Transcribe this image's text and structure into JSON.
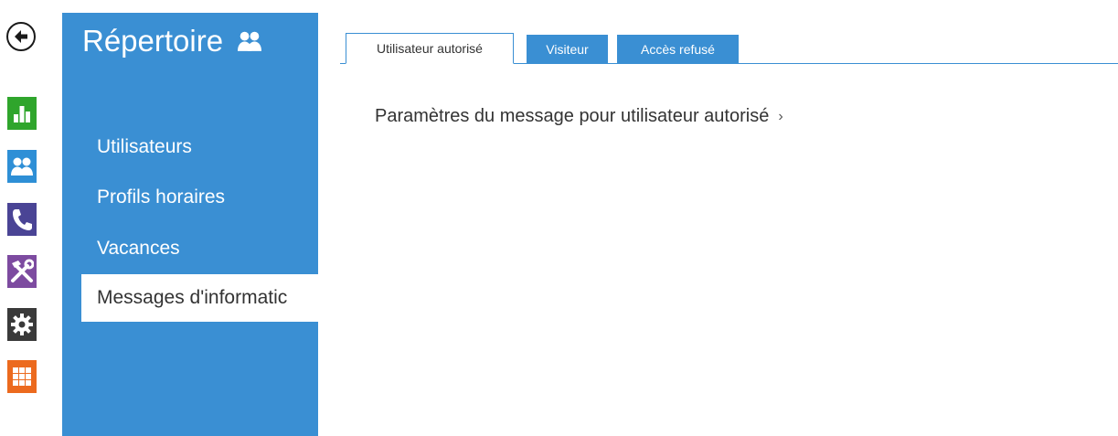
{
  "sidebar_rail": {
    "back_icon": "arrow-left-circle",
    "items": [
      {
        "name": "status",
        "icon": "bar-chart-icon",
        "color": "#2fa52c"
      },
      {
        "name": "directory",
        "icon": "users-icon",
        "color": "#2e8fd6"
      },
      {
        "name": "calls",
        "icon": "phone-icon",
        "color": "#4a4495"
      },
      {
        "name": "hardware",
        "icon": "tools-icon",
        "color": "#7d4ba0"
      },
      {
        "name": "services",
        "icon": "gear-icon",
        "color": "#3a3a3a"
      },
      {
        "name": "system",
        "icon": "grid-icon",
        "color": "#ec6a1e"
      }
    ]
  },
  "panel": {
    "title": "Répertoire",
    "title_icon": "users-icon",
    "color": "#3a8fd3",
    "menu": [
      {
        "label": "Utilisateurs"
      },
      {
        "label": "Profils horaires"
      },
      {
        "label": "Vacances"
      },
      {
        "label": "Messages d'informatic",
        "active": true
      }
    ]
  },
  "tabs": [
    {
      "label": "Utilisateur autorisé",
      "active": true
    },
    {
      "label": "Visiteur",
      "active": false
    },
    {
      "label": "Accès refusé",
      "active": false
    }
  ],
  "content": {
    "link_label": "Paramètres du message pour utilisateur autorisé",
    "link_chevron": "›"
  }
}
